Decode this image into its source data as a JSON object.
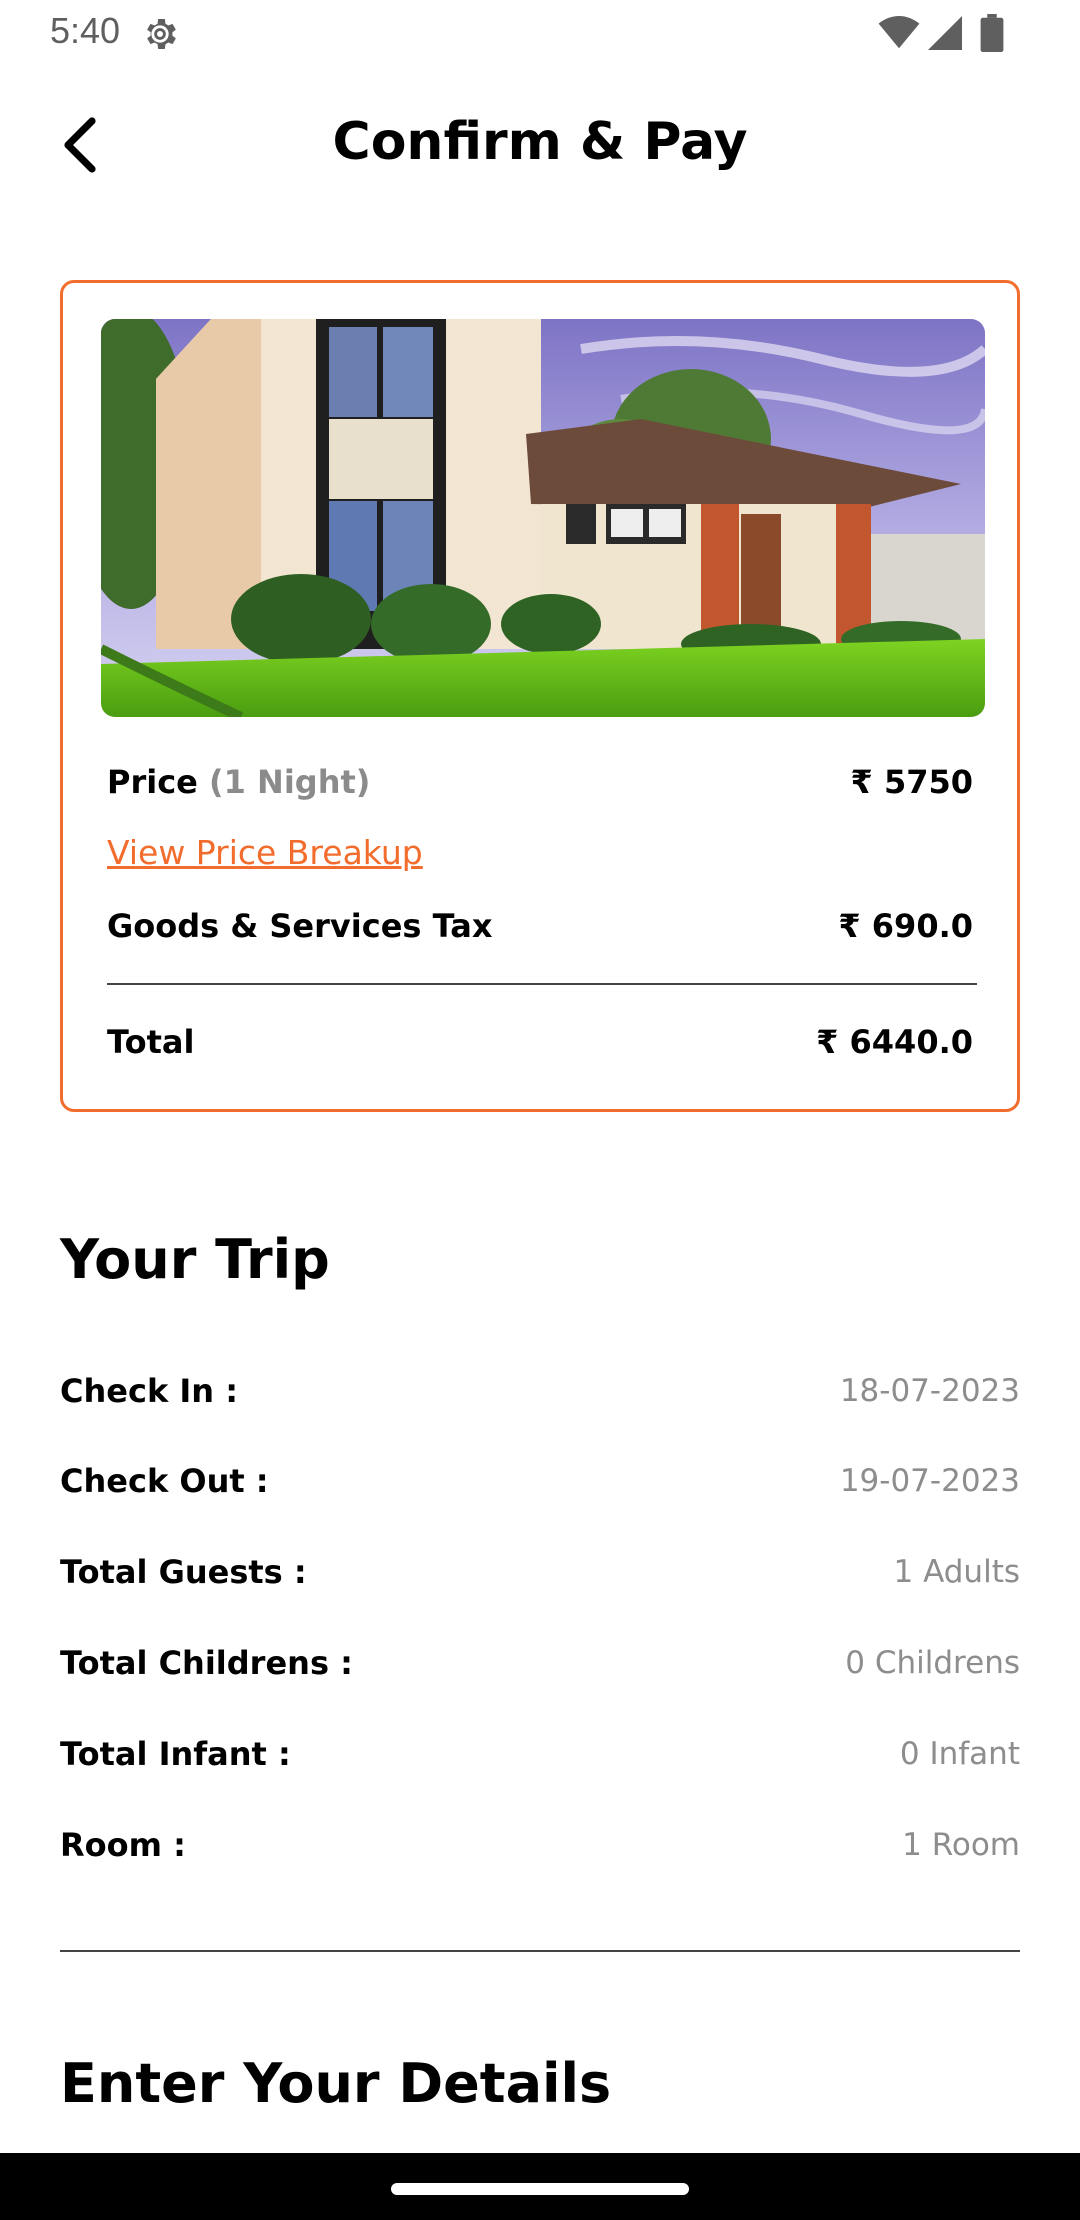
{
  "status_bar": {
    "time": "5:40",
    "icons": [
      "settings-icon",
      "wifi-icon",
      "signal-icon",
      "battery-icon"
    ]
  },
  "header": {
    "title": "Confirm & Pay",
    "back_icon": "chevron-left-icon"
  },
  "colors": {
    "accent": "#f26d2d",
    "muted_text": "#8d8d8d",
    "text": "#000000"
  },
  "booking_card": {
    "price_label": "Price",
    "price_note": "(1 Night)",
    "price_value": "₹ 5750",
    "breakup_link": "View Price Breakup",
    "tax_label": "Goods & Services Tax",
    "tax_value": "₹ 690.0",
    "total_label": "Total",
    "total_value": "₹ 6440.0"
  },
  "trip": {
    "title": "Your Trip",
    "rows": [
      {
        "label": "Check In :",
        "value": "18-07-2023"
      },
      {
        "label": "Check Out :",
        "value": "19-07-2023"
      },
      {
        "label": "Total Guests :",
        "value": "1 Adults"
      },
      {
        "label": "Total Childrens :",
        "value": "0 Childrens"
      },
      {
        "label": "Total Infant :",
        "value": "0 Infant"
      },
      {
        "label": "Room :",
        "value": "1 Room"
      }
    ]
  },
  "details": {
    "title": "Enter Your Details"
  }
}
